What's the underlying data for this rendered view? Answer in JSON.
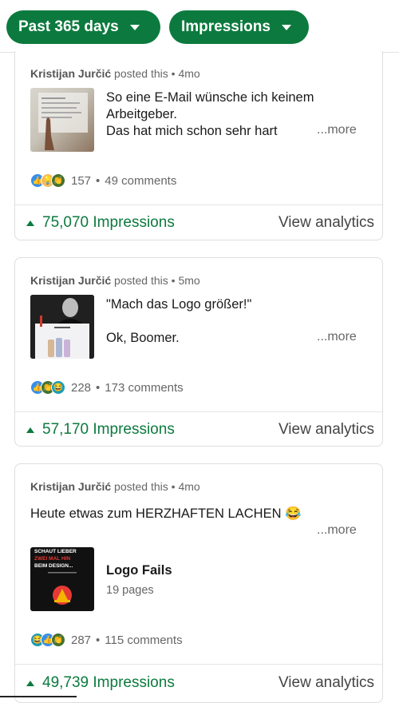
{
  "filters": {
    "date_label": "Past 365 days",
    "metric_label": "Impressions"
  },
  "posts": [
    {
      "author": "Kristijan Jurčić",
      "posted_text": "posted this",
      "age": "4mo",
      "text_lines": [
        "So eine E-Mail wünsche ich keinem",
        "Arbeitgeber.",
        "Das hat mich schon sehr hart"
      ],
      "more": "...more",
      "reaction_icons": [
        "like-icon",
        "insightful-icon",
        "celebrate-icon"
      ],
      "reaction_count": "157",
      "comments": "49 comments",
      "impressions": "75,070 Impressions",
      "view_label": "View analytics"
    },
    {
      "author": "Kristijan Jurčić",
      "posted_text": "posted this",
      "age": "5mo",
      "text_lines": [
        "\"Mach das Logo größer!\"",
        "",
        "Ok, Boomer."
      ],
      "more": "...more",
      "reaction_icons": [
        "like-icon",
        "celebrate-icon",
        "funny-icon"
      ],
      "reaction_count": "228",
      "comments": "173 comments",
      "impressions": "57,170 Impressions",
      "view_label": "View analytics"
    },
    {
      "author": "Kristijan Jurčić",
      "posted_text": "posted this",
      "age": "4mo",
      "text_lines": [
        "Heute etwas zum HERZHAFTEN LACHEN 😂"
      ],
      "more": "...more",
      "document_title": "Logo Fails",
      "document_pages": "19 pages",
      "thumb_text": [
        "SCHAUT LIEBER",
        "ZWEI MAL HIN",
        "BEIM DESIGN..."
      ],
      "reaction_icons": [
        "funny-icon",
        "like-icon",
        "celebrate-icon"
      ],
      "reaction_count": "287",
      "comments": "115 comments",
      "impressions": "49,739 Impressions",
      "view_label": "View analytics"
    }
  ],
  "colors": {
    "accent_green": "#0c7a3e",
    "like_blue": "#378fe9",
    "celebrate_green": "#44712e",
    "insightful_yellow": "#f5bb5c",
    "funny_teal": "#1b9cb5"
  }
}
